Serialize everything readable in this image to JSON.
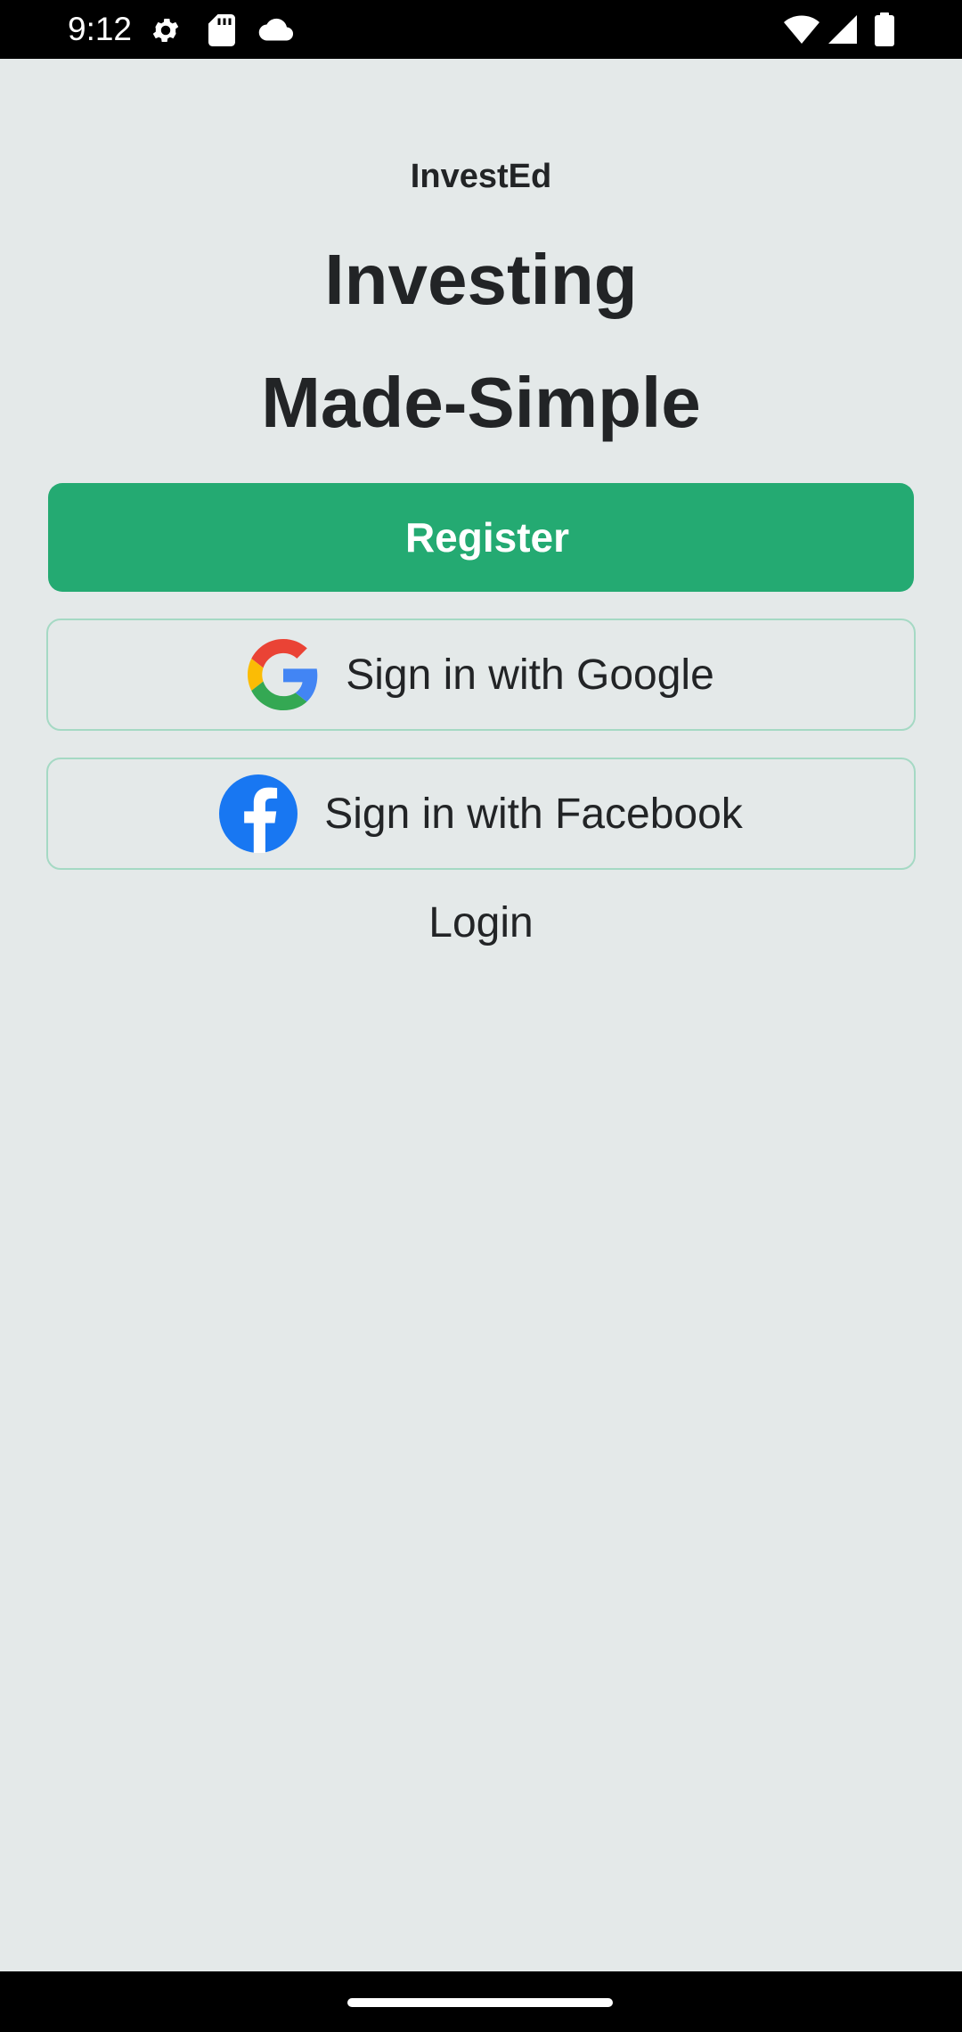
{
  "status_bar": {
    "time": "9:12",
    "left_icons": [
      "gear-icon",
      "sd-card-icon",
      "cloud-icon"
    ],
    "right_icons": [
      "wifi-icon",
      "signal-icon",
      "battery-icon"
    ]
  },
  "app": {
    "brand": "InvestEd",
    "headline_line1": "Investing",
    "headline_line2": "Made-Simple"
  },
  "actions": {
    "register_label": "Register",
    "google_label": "Sign in with Google",
    "facebook_label": "Sign in with Facebook",
    "login_label": "Login"
  },
  "colors": {
    "background": "#E4E9E9",
    "accent": "#24AA72",
    "outline": "#A5D9C4",
    "facebook_blue": "#1877F2"
  }
}
